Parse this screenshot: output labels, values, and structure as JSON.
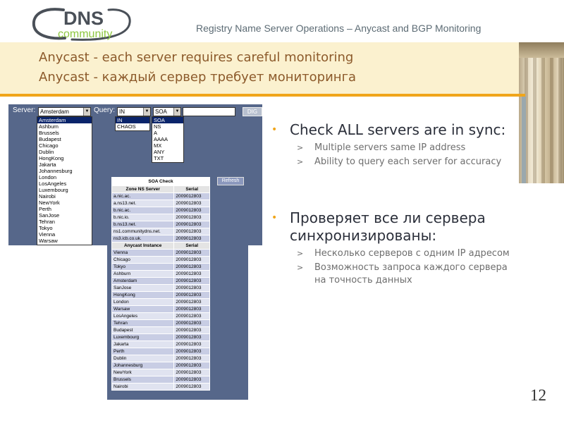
{
  "logo": {
    "top_text": "DNS",
    "bottom_text": "community"
  },
  "header": {
    "subtitle": "Registry Name Server Operations – Anycast and BGP Monitoring"
  },
  "title": {
    "line1": "Anycast - each server requires careful monitoring",
    "line2": "Anycast - каждый сервер требует мониторинга"
  },
  "screenshot": {
    "server_label": "Server:",
    "server_value": "Amsterdam",
    "query_label": "Query:",
    "class_value": "IN",
    "type_value": "SOA",
    "dig_button": "DIG",
    "servers": [
      "Amsterdam",
      "Ashburn",
      "Brussels",
      "Budapest",
      "Chicago",
      "Dublin",
      "HongKong",
      "Jakarta",
      "Johannesburg",
      "London",
      "LosAngeles",
      "Luxembourg",
      "Nairobi",
      "NewYork",
      "Perth",
      "SanJose",
      "Tehran",
      "Tokyo",
      "Vienna",
      "Warsaw"
    ],
    "classes": [
      "IN",
      "CHAOS"
    ],
    "types": [
      "SOA",
      "NS",
      "A",
      "AAAA",
      "MX",
      "ANY",
      "TXT"
    ],
    "soa_check": {
      "caption": "SOA Check",
      "refresh_button": "Refresh",
      "zone_headers": [
        "Zone NS Server",
        "Serial"
      ],
      "zone_rows": [
        [
          "a.nic.ac.",
          "2009012803"
        ],
        [
          "a.ns13.net.",
          "2009012803"
        ],
        [
          "b.nic.ac.",
          "2009012803"
        ],
        [
          "b.nic.io.",
          "2009012803"
        ],
        [
          "b.ns13.net.",
          "2009012803"
        ],
        [
          "ns1.communitydns.net.",
          "2009012803"
        ],
        [
          "ns3.icb.co.uk.",
          "2009012803"
        ]
      ],
      "anycast_headers": [
        "Anycast Instance",
        "Serial"
      ],
      "anycast_rows": [
        [
          "Vienna",
          "2009012803"
        ],
        [
          "Chicago",
          "2009012803"
        ],
        [
          "Tokyo",
          "2009012803"
        ],
        [
          "Ashburn",
          "2009012803"
        ],
        [
          "Amsterdam",
          "2009012803"
        ],
        [
          "SanJose",
          "2009012803"
        ],
        [
          "HongKong",
          "2009012803"
        ],
        [
          "London",
          "2009012803"
        ],
        [
          "Warsaw",
          "2009012803"
        ],
        [
          "LosAngeles",
          "2009012803"
        ],
        [
          "Tehran",
          "2009012803"
        ],
        [
          "Budapest",
          "2009012803"
        ],
        [
          "Luxembourg",
          "2009012803"
        ],
        [
          "Jakarta",
          "2009012803"
        ],
        [
          "Perth",
          "2009012803"
        ],
        [
          "Dublin",
          "2009012803"
        ],
        [
          "Johannesburg",
          "2009012803"
        ],
        [
          "NewYork",
          "2009012803"
        ],
        [
          "Brussels",
          "2009012803"
        ],
        [
          "Nairobi",
          "2009012803"
        ]
      ]
    }
  },
  "bullets": [
    {
      "text": "Check ALL servers are in sync:",
      "subs": [
        "Multiple servers same IP address",
        "Ability to query each server for accuracy"
      ]
    },
    {
      "text": "Проверяет все ли сервера синхронизированы:",
      "subs": [
        "Несколько серверов с одним IP адресом",
        "Возможность запроса каждого сервера на точность данных"
      ]
    }
  ],
  "page_number": "12",
  "colors": {
    "accent_orange": "#f0a51a",
    "title_band": "#fbf1cf",
    "title_text": "#8c5a2b",
    "logo_green": "#8dc63f",
    "panel_blue": "#56678a"
  }
}
